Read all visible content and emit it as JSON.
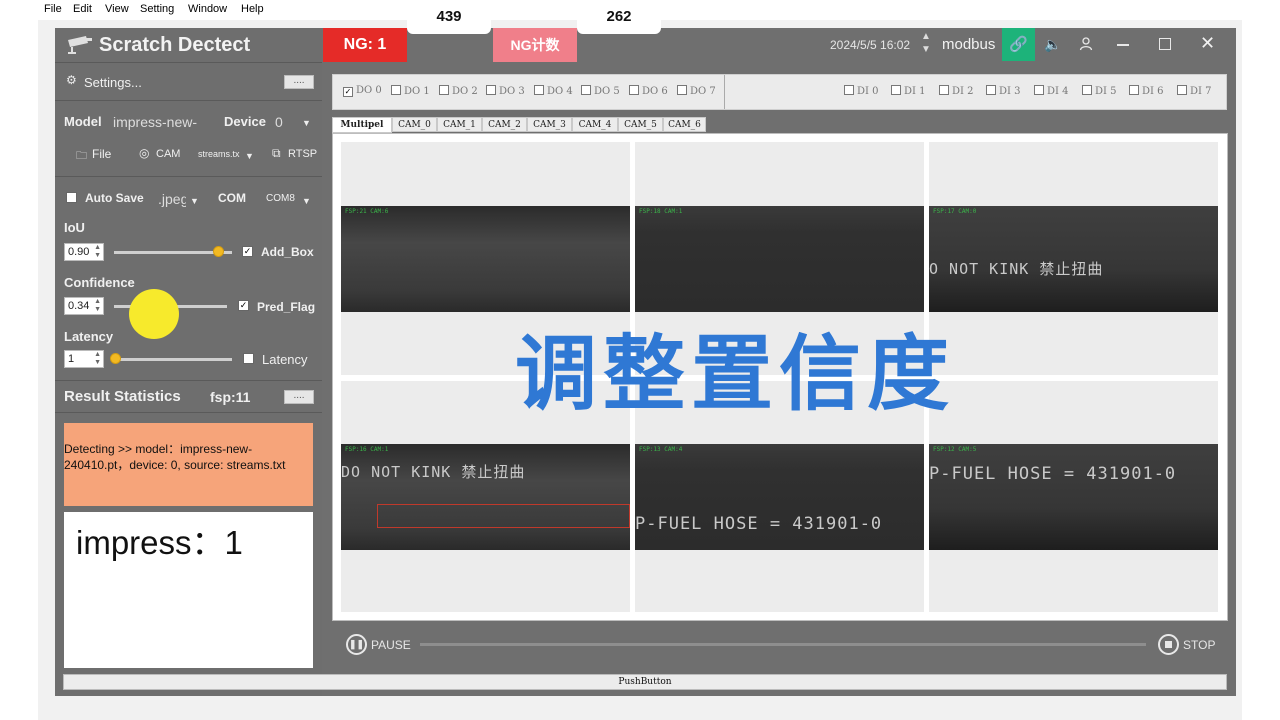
{
  "menu": [
    "File",
    "Edit",
    "View",
    "Setting",
    "Window",
    "Help"
  ],
  "app": {
    "title": "Scratch Dectect",
    "logo_icon": "cctv-camera-icon"
  },
  "header": {
    "ng_label": "NG: 1",
    "ng_value": "439",
    "ng_count_label": "NG计数",
    "ng_count_value": "262",
    "datetime": "2024/5/5 16:02",
    "protocol": "modbus"
  },
  "settings": {
    "label": "Settings...",
    "dots": "...."
  },
  "model": {
    "label": "Model",
    "value": "impress-new-",
    "device_label": "Device",
    "device_value": "0"
  },
  "sources": {
    "file": "File",
    "cam": "CAM",
    "streams": "streams.tx",
    "rtsp": "RTSP"
  },
  "save": {
    "auto_save": "Auto Save",
    "format": ".jpeg",
    "com_label": "COM",
    "com_value": "COM8"
  },
  "iou": {
    "label": "IoU",
    "value": "0.90",
    "slider": 0.9,
    "checkbox_label": "Add_Box",
    "checked": true
  },
  "confidence": {
    "label": "Confidence",
    "value": "0.34",
    "slider": 0.34,
    "checkbox_label": "Pred_Flag",
    "checked": true
  },
  "latency": {
    "label": "Latency",
    "value": "1",
    "slider": 0.0,
    "checkbox_label": "Latency",
    "checked": false
  },
  "stats": {
    "label": "Result Statistics",
    "fps": "fsp:11",
    "dots": "....",
    "status": "Detecting >> model：impress-new-240410.pt，device: 0, source: streams.txt",
    "result": "impress：1"
  },
  "do_items": [
    "DO 0",
    "DO 1",
    "DO 2",
    "DO 3",
    "DO 4",
    "DO 5",
    "DO 6",
    "DO 7"
  ],
  "di_items": [
    "DI 0",
    "DI 1",
    "DI 2",
    "DI 3",
    "DI 4",
    "DI 5",
    "DI 6",
    "DI 7"
  ],
  "tabs": [
    "Multipel",
    "CAM_0",
    "CAM_1",
    "CAM_2",
    "CAM_3",
    "CAM_4",
    "CAM_5",
    "CAM_6"
  ],
  "cams": [
    {
      "hud": "FSP:21  CAM:6",
      "text": ""
    },
    {
      "hud": "FSP:18  CAM:1",
      "text": ""
    },
    {
      "hud": "FSP:17  CAM:0",
      "text": "O NOT KINK 禁止扭曲"
    },
    {
      "hud": "FSP:16  CAM:1",
      "text": "DO NOT KINK 禁止扭曲"
    },
    {
      "hud": "FSP:13  CAM:4",
      "text": "P-FUEL HOSE    = 431901-0"
    },
    {
      "hud": "FSP:12  CAM:5",
      "text": "P-FUEL HOSE    = 431901-0"
    }
  ],
  "overlay_text": "调整置信度",
  "controls": {
    "pause": "PAUSE",
    "stop": "STOP"
  },
  "push_button": "PushButton",
  "colors": {
    "ng_red": "#e52b28",
    "ng_count_pink": "#f07f8a",
    "status_orange": "#f6a47a",
    "accent_yellow": "#f2b922",
    "link_green": "#1db37a",
    "overlay_blue": "#2f78d4"
  }
}
